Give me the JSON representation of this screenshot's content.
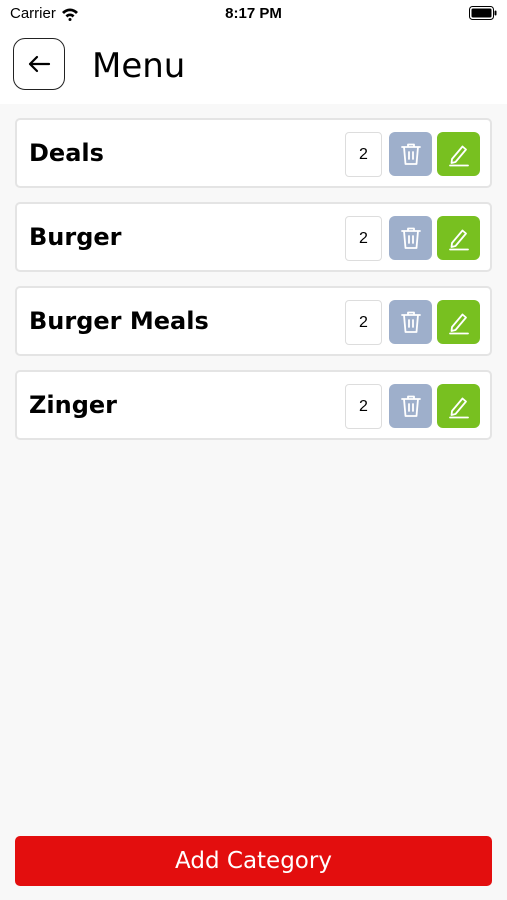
{
  "status_bar": {
    "carrier": "Carrier",
    "time": "8:17 PM"
  },
  "header": {
    "title": "Menu",
    "back_icon": "arrow-left-icon"
  },
  "categories": [
    {
      "name": "Deals",
      "count": "2"
    },
    {
      "name": "Burger",
      "count": "2"
    },
    {
      "name": "Burger Meals",
      "count": "2"
    },
    {
      "name": "Zinger",
      "count": "2"
    }
  ],
  "row_actions": {
    "delete_icon": "trash-icon",
    "edit_icon": "pencil-icon"
  },
  "footer": {
    "add_button_label": "Add Category"
  },
  "colors": {
    "delete": "#9eafcb",
    "edit": "#78c020",
    "primary": "#e30e0e"
  }
}
